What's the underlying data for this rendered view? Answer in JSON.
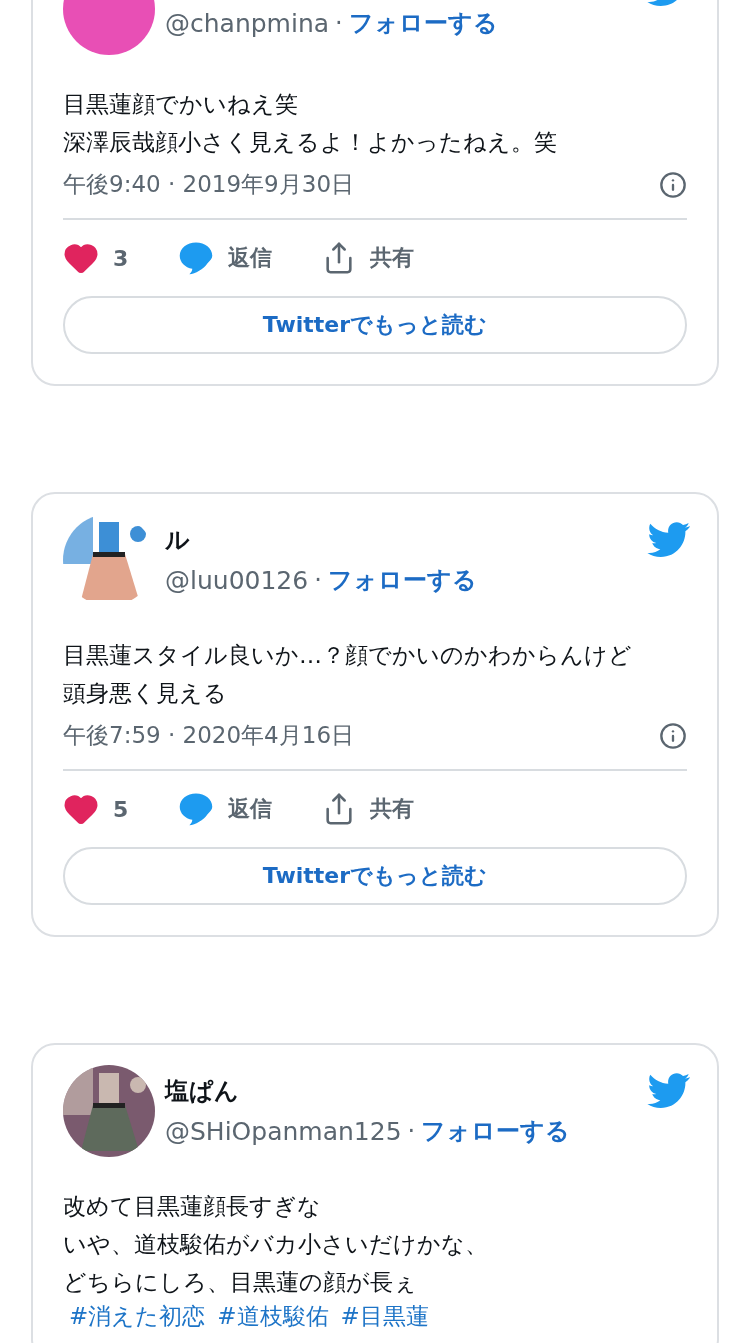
{
  "tweets": [
    {
      "avatar": {
        "kind": "plain",
        "color": "#e84fb5"
      },
      "handle": "@chanpmina",
      "separator": "·",
      "follow": "フォローする",
      "lines": [
        "目黒蓮顔でかいねえ笑",
        "深澤辰哉顔小さく見えるよ！よかったねえ。笑"
      ],
      "time": "午後9:40 · 2019年9月30日",
      "likes": "3",
      "reply": "返信",
      "share": "共有",
      "read_more": "Twitterでもっと読む"
    },
    {
      "avatar": {
        "kind": "picture"
      },
      "name": "ル",
      "handle": "@luu00126",
      "separator": "·",
      "follow": "フォローする",
      "lines": [
        "目黒蓮スタイル良いか…？顔でかいのかわからんけど",
        "頭身悪く見える"
      ],
      "time": "午後7:59 · 2020年4月16日",
      "likes": "5",
      "reply": "返信",
      "share": "共有",
      "read_more": "Twitterでもっと読む"
    },
    {
      "avatar": {
        "kind": "picture"
      },
      "name": "塩ぱん",
      "handle": "@SHiOpanman125",
      "separator": "·",
      "follow": "フォローする",
      "lines": [
        "改めて目黒蓮顔長すぎな",
        "いや、道枝駿佑がバカ小さいだけかな、",
        "どちらにしろ、目黒蓮の顔が長ぇ"
      ],
      "hashtags": [
        "#消えた初恋",
        "#道枝駿佑",
        "#目黒蓮"
      ]
    }
  ]
}
